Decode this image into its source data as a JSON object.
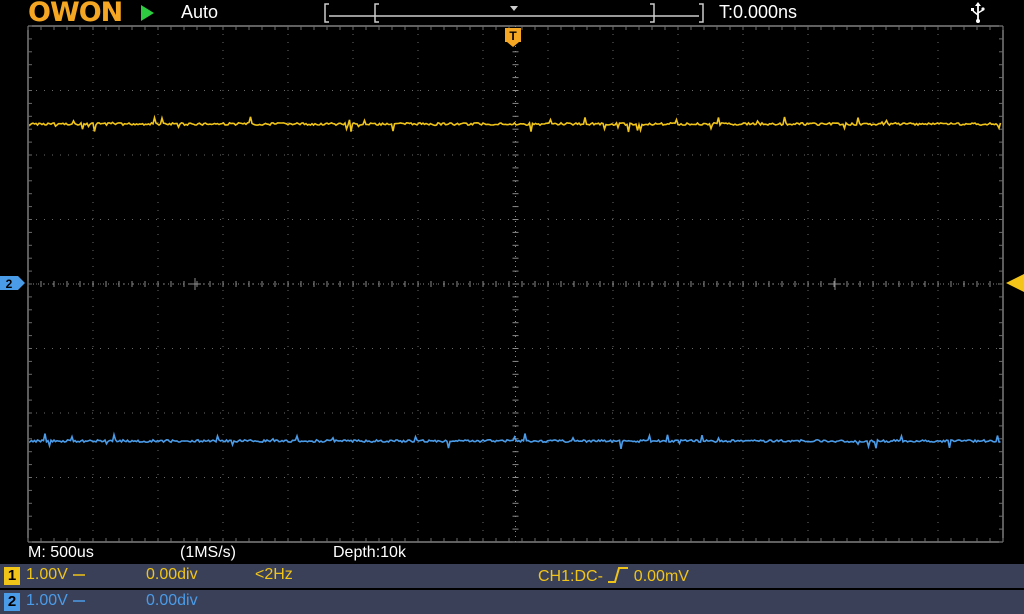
{
  "header": {
    "logo_text": "OWON",
    "run_state_icon": "play-icon",
    "trigger_mode": "Auto",
    "trigger_time": "T:0.000ns",
    "usb_icon": "usb-icon"
  },
  "screen": {
    "trigger_marker_label": "T",
    "ch1_color": "#f0c419",
    "ch2_color": "#4a9be8"
  },
  "status": {
    "timebase": "M: 500us",
    "sample_rate": "(1MS/s)",
    "depth": "Depth:10k",
    "ch1": {
      "num": "1",
      "scale": "1.00V",
      "position": "0.00div",
      "freq": "<2Hz"
    },
    "ch2": {
      "num": "2",
      "scale": "1.00V",
      "position": "0.00div"
    },
    "trigger_info_prefix": "CH1:DC-",
    "trigger_level": "0.00mV"
  }
}
